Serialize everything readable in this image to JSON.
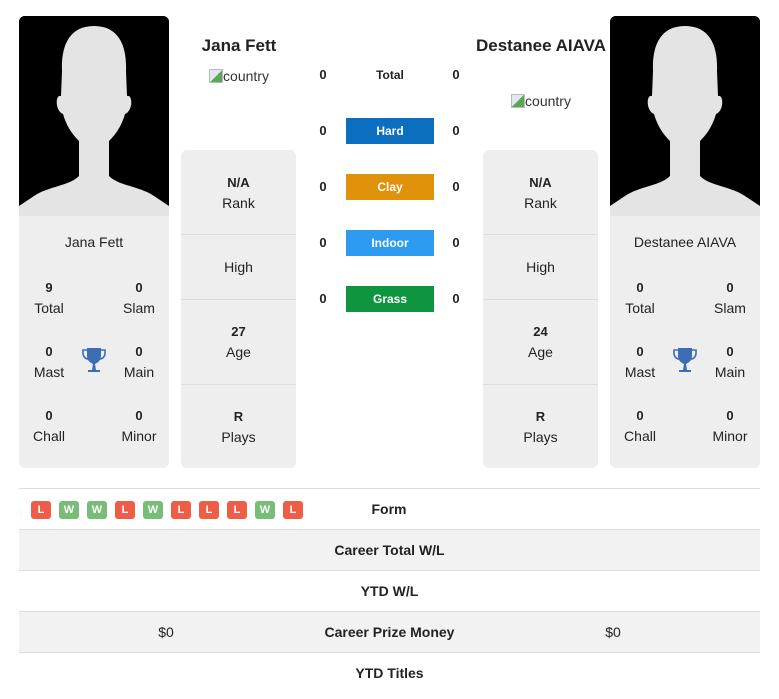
{
  "colors": {
    "hard": "#0c6ebf",
    "clay": "#e0920b",
    "indoor": "#2c9bf0",
    "grass": "#0f9440",
    "win": "#77bc77",
    "loss": "#ee5d47",
    "trophy": "#3c6db5"
  },
  "player1": {
    "name": "Jana Fett",
    "flag_alt": "country",
    "titles": {
      "name": "Jana Fett",
      "total": {
        "value": "9",
        "label": "Total"
      },
      "slam": {
        "value": "0",
        "label": "Slam"
      },
      "mast": {
        "value": "0",
        "label": "Mast"
      },
      "main": {
        "value": "0",
        "label": "Main"
      },
      "chall": {
        "value": "0",
        "label": "Chall"
      },
      "minor": {
        "value": "0",
        "label": "Minor"
      }
    },
    "info": {
      "rank": {
        "value": "N/A",
        "label": "Rank"
      },
      "high": {
        "label": "High"
      },
      "age": {
        "value": "27",
        "label": "Age"
      },
      "plays": {
        "value": "R",
        "label": "Plays"
      }
    }
  },
  "player2": {
    "name": "Destanee AIAVA",
    "flag_alt": "country",
    "titles": {
      "name": "Destanee AIAVA",
      "total": {
        "value": "0",
        "label": "Total"
      },
      "slam": {
        "value": "0",
        "label": "Slam"
      },
      "mast": {
        "value": "0",
        "label": "Mast"
      },
      "main": {
        "value": "0",
        "label": "Main"
      },
      "chall": {
        "value": "0",
        "label": "Chall"
      },
      "minor": {
        "value": "0",
        "label": "Minor"
      }
    },
    "info": {
      "rank": {
        "value": "N/A",
        "label": "Rank"
      },
      "high": {
        "label": "High"
      },
      "age": {
        "value": "24",
        "label": "Age"
      },
      "plays": {
        "value": "R",
        "label": "Plays"
      }
    }
  },
  "h2h": [
    {
      "label": "Total",
      "left": "0",
      "right": "0",
      "surface": "total"
    },
    {
      "label": "Hard",
      "left": "0",
      "right": "0",
      "surface": "hard"
    },
    {
      "label": "Clay",
      "left": "0",
      "right": "0",
      "surface": "clay"
    },
    {
      "label": "Indoor",
      "left": "0",
      "right": "0",
      "surface": "indoor"
    },
    {
      "label": "Grass",
      "left": "0",
      "right": "0",
      "surface": "grass"
    }
  ],
  "form": {
    "label": "Form",
    "results": [
      "L",
      "W",
      "W",
      "L",
      "W",
      "L",
      "L",
      "L",
      "W",
      "L"
    ]
  },
  "stats": [
    {
      "label": "Career Total W/L",
      "left": "",
      "right": ""
    },
    {
      "label": "YTD W/L",
      "left": "",
      "right": ""
    },
    {
      "label": "Career Prize Money",
      "left": "$0",
      "right": "$0"
    },
    {
      "label": "YTD Titles",
      "left": "",
      "right": ""
    }
  ]
}
